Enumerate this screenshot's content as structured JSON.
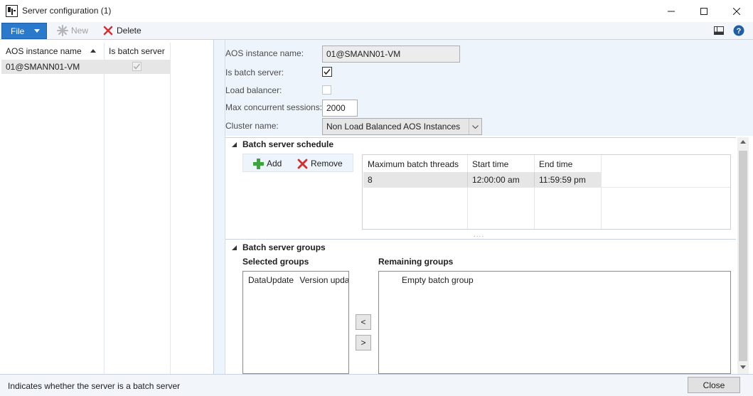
{
  "window": {
    "title": "Server configuration (1)"
  },
  "toolbar": {
    "file_label": "File",
    "new_label": "New",
    "delete_label": "Delete"
  },
  "grid": {
    "columns": [
      "AOS instance name",
      "Is batch server"
    ],
    "rows": [
      {
        "aos_instance_name": "01@SMANN01-VM",
        "is_batch_server": true
      }
    ]
  },
  "form": {
    "aos_instance_name": {
      "label": "AOS instance name:",
      "value": "01@SMANN01-VM"
    },
    "is_batch_server": {
      "label": "Is batch server:",
      "checked": true
    },
    "load_balancer": {
      "label": "Load balancer:",
      "checked": false
    },
    "max_sessions": {
      "label": "Max concurrent sessions:",
      "value": "2000"
    },
    "cluster_name": {
      "label": "Cluster name:",
      "value": "Non Load Balanced AOS Instances"
    }
  },
  "schedule": {
    "title": "Batch server schedule",
    "add_label": "Add",
    "remove_label": "Remove",
    "columns": [
      "Maximum batch threads",
      "Start time",
      "End time"
    ],
    "rows": [
      {
        "threads": "8",
        "start": "12:00:00 am",
        "end": "11:59:59 pm"
      }
    ],
    "splitter_glyph": "...."
  },
  "groups": {
    "title": "Batch server groups",
    "selected_title": "Selected groups",
    "remaining_title": "Remaining groups",
    "selected_items": [
      "DataUpdate",
      "Version updat"
    ],
    "remaining_items": [
      "Empty batch group"
    ],
    "move_left_label": "<",
    "move_right_label": ">"
  },
  "status": {
    "text": "Indicates whether the server is a batch server",
    "close_label": "Close"
  },
  "colors": {
    "accent": "#2b79cc",
    "pane_background": "#eef4fb",
    "add_icon": "#3aa53a",
    "delete_icon": "#d32f2f",
    "help_icon": "#1f5fa6"
  }
}
